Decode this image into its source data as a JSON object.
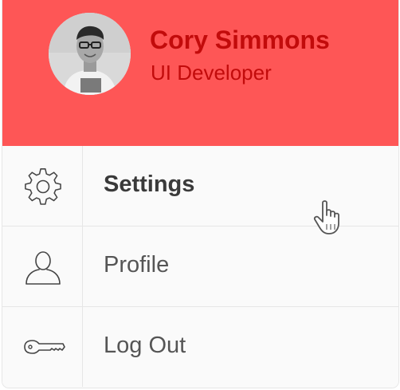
{
  "profile": {
    "name": "Cory Simmons",
    "role": "UI Developer",
    "avatar_icon": "user-photo",
    "header_color": "#fe5656",
    "text_color": "#c20b0b"
  },
  "menu": {
    "items": [
      {
        "label": "Settings",
        "icon": "gear-icon",
        "active": true
      },
      {
        "label": "Profile",
        "icon": "person-icon",
        "active": false
      },
      {
        "label": "Log Out",
        "icon": "key-icon",
        "active": false
      }
    ]
  },
  "pointer": {
    "icon": "hand-pointer-icon"
  }
}
